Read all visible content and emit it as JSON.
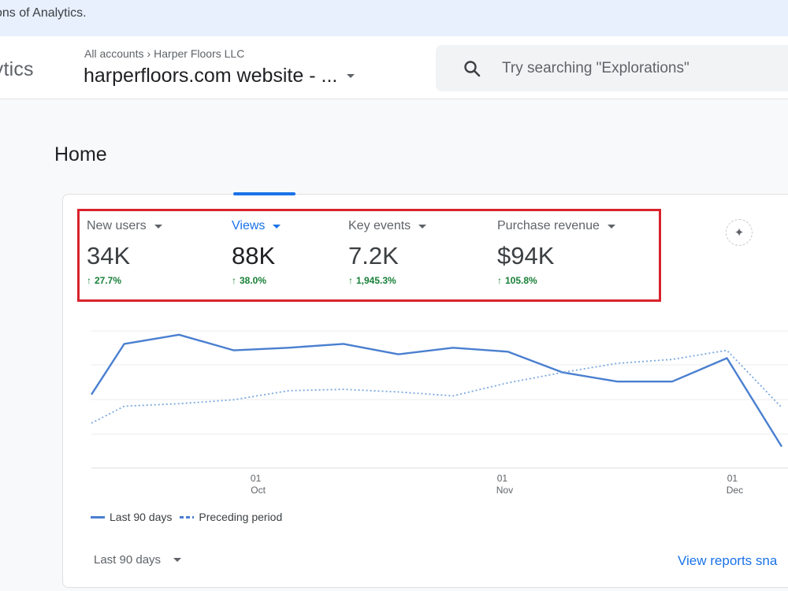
{
  "banner": {
    "text": "ons of Analytics."
  },
  "header": {
    "app_name": "lytics",
    "breadcrumb": {
      "root": "All accounts",
      "account": "Harper Floors LLC"
    },
    "property": "harperfloors.com website - ...",
    "search": {
      "placeholder": "Try searching \"Explorations\"",
      "icon": "search-icon"
    }
  },
  "page": {
    "title": "Home"
  },
  "metrics": [
    {
      "label": "New users",
      "value": "34K",
      "change": "27.7%",
      "active": false
    },
    {
      "label": "Views",
      "value": "88K",
      "change": "38.0%",
      "active": true
    },
    {
      "label": "Key events",
      "value": "7.2K",
      "change": "1,945.3%",
      "active": false
    },
    {
      "label": "Purchase revenue",
      "value": "$94K",
      "change": "105.8%",
      "active": false
    }
  ],
  "chart_data": {
    "type": "line",
    "x_ticks": [
      {
        "day": "01",
        "month": "Oct",
        "index": 3
      },
      {
        "day": "01",
        "month": "Nov",
        "index": 7.5
      },
      {
        "day": "01",
        "month": "Dec",
        "index": 11.7
      }
    ],
    "x": [
      0,
      0.6,
      1.6,
      2.6,
      3.6,
      4.6,
      5.6,
      6.6,
      7.6,
      8.6,
      9.6,
      10.6,
      11.6,
      12.6
    ],
    "series": [
      {
        "name": "Last 90 days",
        "style": "solid",
        "color": "#4a7fd0",
        "values": [
          0.42,
          0.81,
          0.88,
          0.76,
          0.78,
          0.81,
          0.73,
          0.78,
          0.75,
          0.59,
          0.52,
          0.52,
          0.7,
          0.02
        ]
      },
      {
        "name": "Preceding period",
        "style": "dashed",
        "color": "#7aa7e0",
        "values": [
          0.2,
          0.33,
          0.35,
          0.38,
          0.45,
          0.46,
          0.44,
          0.41,
          0.51,
          0.59,
          0.66,
          0.69,
          0.76,
          0.32
        ]
      }
    ],
    "ylim": [
      0,
      1
    ],
    "grid": true
  },
  "legend": {
    "current": "Last 90 days",
    "previous": "Preceding period"
  },
  "footer": {
    "range": "Last 90 days",
    "view_link": "View reports sna"
  },
  "colors": {
    "accent": "#1a73e8",
    "positive": "#188038",
    "highlight": "#d9232d"
  }
}
